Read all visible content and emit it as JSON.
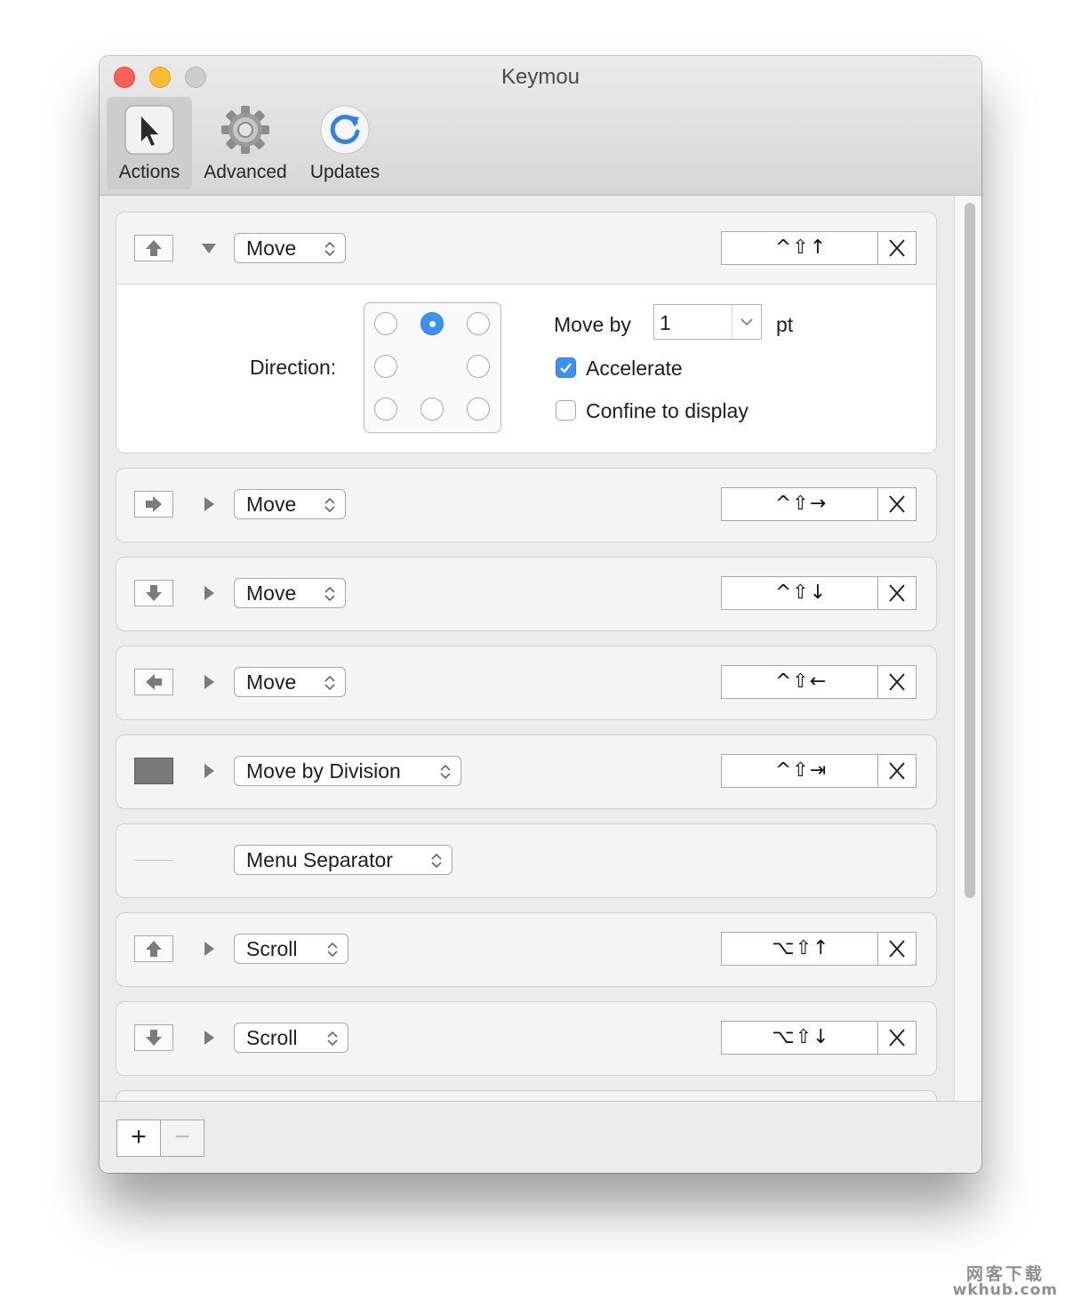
{
  "window": {
    "title": "Keymou",
    "toolbar": [
      {
        "label": "Actions",
        "icon": "cursor-arrow-icon",
        "selected": true
      },
      {
        "label": "Advanced",
        "icon": "gear-icon",
        "selected": false
      },
      {
        "label": "Updates",
        "icon": "refresh-icon",
        "selected": false
      }
    ]
  },
  "actions": [
    {
      "icon": "arrow-up-icon",
      "expanded": true,
      "action": "Move",
      "shortcut": "^⇧↑"
    },
    {
      "icon": "arrow-right-icon",
      "expanded": false,
      "action": "Move",
      "shortcut": "^⇧→"
    },
    {
      "icon": "arrow-down-icon",
      "expanded": false,
      "action": "Move",
      "shortcut": "^⇧↓"
    },
    {
      "icon": "arrow-left-icon",
      "expanded": false,
      "action": "Move",
      "shortcut": "^⇧←"
    },
    {
      "icon": "division-block-icon",
      "expanded": false,
      "action": "Move by Division",
      "shortcut": "^⇧⇥"
    },
    {
      "icon": "separator-line-icon",
      "expanded": false,
      "action": "Menu Separator",
      "shortcut": ""
    },
    {
      "icon": "arrow-up-icon",
      "expanded": false,
      "action": "Scroll",
      "shortcut": "⌥⇧↑"
    },
    {
      "icon": "arrow-down-icon",
      "expanded": false,
      "action": "Scroll",
      "shortcut": "⌥⇧↓"
    }
  ],
  "detail": {
    "direction_label": "Direction:",
    "direction_selected": "top-center",
    "move_by_label": "Move by",
    "move_by_value": "1",
    "unit_label": "pt",
    "accelerate_label": "Accelerate",
    "accelerate_checked": true,
    "confine_label": "Confine to display",
    "confine_checked": false
  },
  "bottombar": {
    "add_label": "+",
    "remove_label": "−"
  },
  "watermark": {
    "line1": "网客下载",
    "line2": "wkhub.com"
  },
  "colors": {
    "accent": "#3b91f5",
    "close": "#fc5f57",
    "minimize": "#fdbc2e"
  }
}
